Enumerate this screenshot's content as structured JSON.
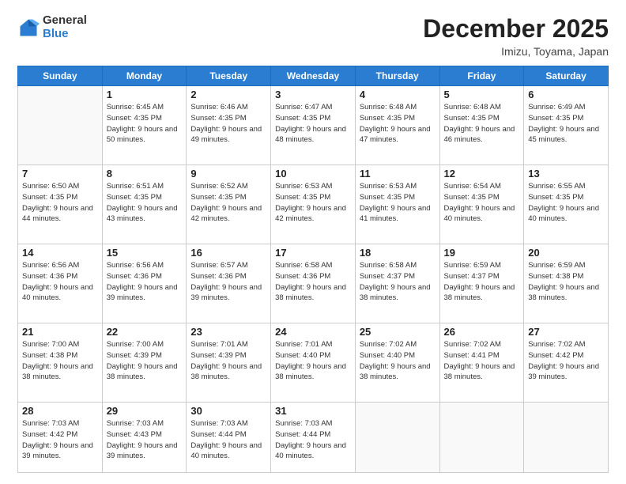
{
  "logo": {
    "general": "General",
    "blue": "Blue"
  },
  "title": {
    "month": "December 2025",
    "location": "Imizu, Toyama, Japan"
  },
  "weekdays": [
    "Sunday",
    "Monday",
    "Tuesday",
    "Wednesday",
    "Thursday",
    "Friday",
    "Saturday"
  ],
  "weeks": [
    [
      {
        "day": "",
        "sunrise": "",
        "sunset": "",
        "daylight": ""
      },
      {
        "day": "1",
        "sunrise": "Sunrise: 6:45 AM",
        "sunset": "Sunset: 4:35 PM",
        "daylight": "Daylight: 9 hours and 50 minutes."
      },
      {
        "day": "2",
        "sunrise": "Sunrise: 6:46 AM",
        "sunset": "Sunset: 4:35 PM",
        "daylight": "Daylight: 9 hours and 49 minutes."
      },
      {
        "day": "3",
        "sunrise": "Sunrise: 6:47 AM",
        "sunset": "Sunset: 4:35 PM",
        "daylight": "Daylight: 9 hours and 48 minutes."
      },
      {
        "day": "4",
        "sunrise": "Sunrise: 6:48 AM",
        "sunset": "Sunset: 4:35 PM",
        "daylight": "Daylight: 9 hours and 47 minutes."
      },
      {
        "day": "5",
        "sunrise": "Sunrise: 6:48 AM",
        "sunset": "Sunset: 4:35 PM",
        "daylight": "Daylight: 9 hours and 46 minutes."
      },
      {
        "day": "6",
        "sunrise": "Sunrise: 6:49 AM",
        "sunset": "Sunset: 4:35 PM",
        "daylight": "Daylight: 9 hours and 45 minutes."
      }
    ],
    [
      {
        "day": "7",
        "sunrise": "Sunrise: 6:50 AM",
        "sunset": "Sunset: 4:35 PM",
        "daylight": "Daylight: 9 hours and 44 minutes."
      },
      {
        "day": "8",
        "sunrise": "Sunrise: 6:51 AM",
        "sunset": "Sunset: 4:35 PM",
        "daylight": "Daylight: 9 hours and 43 minutes."
      },
      {
        "day": "9",
        "sunrise": "Sunrise: 6:52 AM",
        "sunset": "Sunset: 4:35 PM",
        "daylight": "Daylight: 9 hours and 42 minutes."
      },
      {
        "day": "10",
        "sunrise": "Sunrise: 6:53 AM",
        "sunset": "Sunset: 4:35 PM",
        "daylight": "Daylight: 9 hours and 42 minutes."
      },
      {
        "day": "11",
        "sunrise": "Sunrise: 6:53 AM",
        "sunset": "Sunset: 4:35 PM",
        "daylight": "Daylight: 9 hours and 41 minutes."
      },
      {
        "day": "12",
        "sunrise": "Sunrise: 6:54 AM",
        "sunset": "Sunset: 4:35 PM",
        "daylight": "Daylight: 9 hours and 40 minutes."
      },
      {
        "day": "13",
        "sunrise": "Sunrise: 6:55 AM",
        "sunset": "Sunset: 4:35 PM",
        "daylight": "Daylight: 9 hours and 40 minutes."
      }
    ],
    [
      {
        "day": "14",
        "sunrise": "Sunrise: 6:56 AM",
        "sunset": "Sunset: 4:36 PM",
        "daylight": "Daylight: 9 hours and 40 minutes."
      },
      {
        "day": "15",
        "sunrise": "Sunrise: 6:56 AM",
        "sunset": "Sunset: 4:36 PM",
        "daylight": "Daylight: 9 hours and 39 minutes."
      },
      {
        "day": "16",
        "sunrise": "Sunrise: 6:57 AM",
        "sunset": "Sunset: 4:36 PM",
        "daylight": "Daylight: 9 hours and 39 minutes."
      },
      {
        "day": "17",
        "sunrise": "Sunrise: 6:58 AM",
        "sunset": "Sunset: 4:36 PM",
        "daylight": "Daylight: 9 hours and 38 minutes."
      },
      {
        "day": "18",
        "sunrise": "Sunrise: 6:58 AM",
        "sunset": "Sunset: 4:37 PM",
        "daylight": "Daylight: 9 hours and 38 minutes."
      },
      {
        "day": "19",
        "sunrise": "Sunrise: 6:59 AM",
        "sunset": "Sunset: 4:37 PM",
        "daylight": "Daylight: 9 hours and 38 minutes."
      },
      {
        "day": "20",
        "sunrise": "Sunrise: 6:59 AM",
        "sunset": "Sunset: 4:38 PM",
        "daylight": "Daylight: 9 hours and 38 minutes."
      }
    ],
    [
      {
        "day": "21",
        "sunrise": "Sunrise: 7:00 AM",
        "sunset": "Sunset: 4:38 PM",
        "daylight": "Daylight: 9 hours and 38 minutes."
      },
      {
        "day": "22",
        "sunrise": "Sunrise: 7:00 AM",
        "sunset": "Sunset: 4:39 PM",
        "daylight": "Daylight: 9 hours and 38 minutes."
      },
      {
        "day": "23",
        "sunrise": "Sunrise: 7:01 AM",
        "sunset": "Sunset: 4:39 PM",
        "daylight": "Daylight: 9 hours and 38 minutes."
      },
      {
        "day": "24",
        "sunrise": "Sunrise: 7:01 AM",
        "sunset": "Sunset: 4:40 PM",
        "daylight": "Daylight: 9 hours and 38 minutes."
      },
      {
        "day": "25",
        "sunrise": "Sunrise: 7:02 AM",
        "sunset": "Sunset: 4:40 PM",
        "daylight": "Daylight: 9 hours and 38 minutes."
      },
      {
        "day": "26",
        "sunrise": "Sunrise: 7:02 AM",
        "sunset": "Sunset: 4:41 PM",
        "daylight": "Daylight: 9 hours and 38 minutes."
      },
      {
        "day": "27",
        "sunrise": "Sunrise: 7:02 AM",
        "sunset": "Sunset: 4:42 PM",
        "daylight": "Daylight: 9 hours and 39 minutes."
      }
    ],
    [
      {
        "day": "28",
        "sunrise": "Sunrise: 7:03 AM",
        "sunset": "Sunset: 4:42 PM",
        "daylight": "Daylight: 9 hours and 39 minutes."
      },
      {
        "day": "29",
        "sunrise": "Sunrise: 7:03 AM",
        "sunset": "Sunset: 4:43 PM",
        "daylight": "Daylight: 9 hours and 39 minutes."
      },
      {
        "day": "30",
        "sunrise": "Sunrise: 7:03 AM",
        "sunset": "Sunset: 4:44 PM",
        "daylight": "Daylight: 9 hours and 40 minutes."
      },
      {
        "day": "31",
        "sunrise": "Sunrise: 7:03 AM",
        "sunset": "Sunset: 4:44 PM",
        "daylight": "Daylight: 9 hours and 40 minutes."
      },
      {
        "day": "",
        "sunrise": "",
        "sunset": "",
        "daylight": ""
      },
      {
        "day": "",
        "sunrise": "",
        "sunset": "",
        "daylight": ""
      },
      {
        "day": "",
        "sunrise": "",
        "sunset": "",
        "daylight": ""
      }
    ]
  ]
}
